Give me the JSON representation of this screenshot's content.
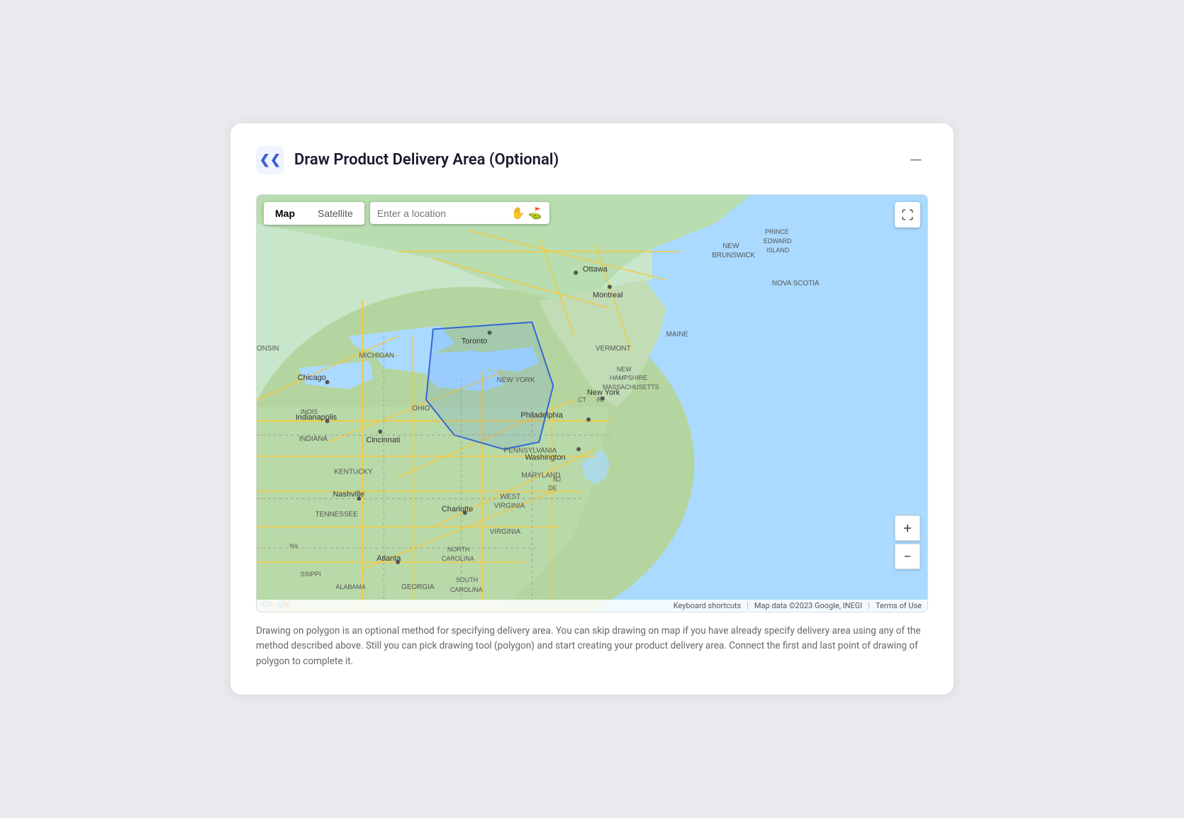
{
  "header": {
    "title": "Draw Product Delivery Area (Optional)",
    "back_label": "←",
    "minimize_label": "—"
  },
  "map": {
    "type_buttons": [
      {
        "label": "Map",
        "active": true
      },
      {
        "label": "Satellite",
        "active": false
      }
    ],
    "location_placeholder": "Enter a location",
    "fullscreen_label": "⛶",
    "zoom_in_label": "+",
    "zoom_out_label": "−",
    "attribution": {
      "keyboard_shortcuts": "Keyboard shortcuts",
      "map_data": "Map data ©2023 Google, INEGI",
      "terms": "Terms of Use"
    },
    "google_logo": "Google"
  },
  "description": "Drawing on polygon is an optional method for specifying delivery area. You can skip drawing on map if you have already specify delivery area using any of the method described above. Still you can pick drawing tool (polygon) and start creating your product delivery area. Connect the first and last point of drawing of polygon to complete it."
}
